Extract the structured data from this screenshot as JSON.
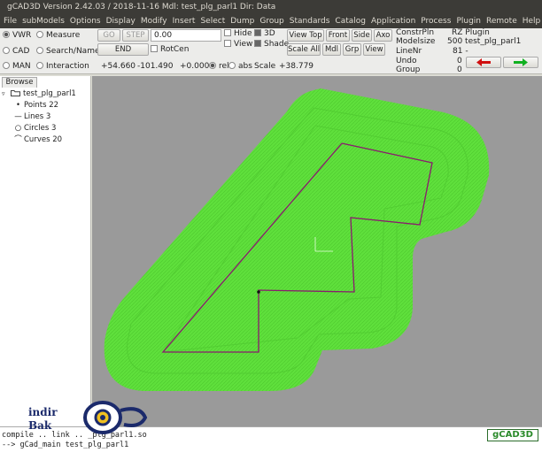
{
  "window": {
    "title": "gCAD3D Version 2.42.03 / 2018-11-16   Mdl: test_plg_parl1   Dir: Data"
  },
  "menu": [
    "File",
    "subModels",
    "Options",
    "Display",
    "Modify",
    "Insert",
    "Select",
    "Dump",
    "Group",
    "Standards",
    "Catalog",
    "Application",
    "Process",
    "Plugin",
    "Remote",
    "Help"
  ],
  "modes": {
    "vwr": "VWR",
    "cad": "CAD",
    "man": "MAN",
    "measure": "Measure",
    "search": "Search/Name",
    "interaction": "Interaction"
  },
  "toolbar": {
    "go": "GO",
    "step": "STEP",
    "end": "END",
    "entry_value": "0.00",
    "rotcen": "RotCen",
    "hide": "Hide",
    "view": "View",
    "three_d": "3D",
    "shade": "Shade",
    "view_top": "View Top",
    "front": "Front",
    "side": "Side",
    "axo": "Axo",
    "scale_all": "Scale All",
    "mdl": "Mdl",
    "grp": "Grp",
    "view_btn": "View"
  },
  "coords": {
    "x": "+54.660",
    "y": "-101.490",
    "z": "+0.000",
    "rel": "rel",
    "abs": "abs",
    "scale_label": "Scale",
    "scale": "+38.779"
  },
  "info": {
    "constr_label": "ConstrPln",
    "constr_value": "RZ Plugin",
    "modelsize_label": "Modelsize",
    "modelsize_value": "500 test_plg_parl1",
    "linenr_label": "LineNr",
    "linenr_value": "81 -",
    "undo_label": "Undo",
    "undo_value": "0",
    "group_label": "Group",
    "group_value": "0"
  },
  "browse": {
    "tab": "Browse",
    "root": "test_plg_parl1",
    "items": [
      {
        "icon": "point-icon",
        "label": "Points 22"
      },
      {
        "icon": "line-icon",
        "label": "Lines 3"
      },
      {
        "icon": "circle-icon",
        "label": "Circles 3"
      },
      {
        "icon": "curve-icon",
        "label": "Curves 20"
      }
    ]
  },
  "console": {
    "line1": "compile .. link .. _plg_parl1.so",
    "line2": "--> gCad_main test_plg_parl1"
  },
  "logo": "gCAD3D",
  "watermark": {
    "top": "indir",
    "bottom": "Bak"
  },
  "colors": {
    "offset_green": "#5fe03c",
    "profile": "#8a1a6e",
    "viewport": "#9a9a9a"
  }
}
